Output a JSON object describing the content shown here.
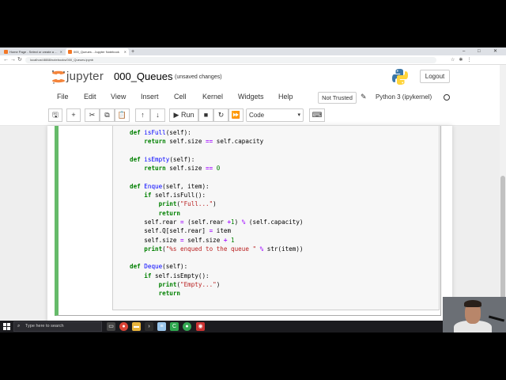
{
  "browser": {
    "tabs": [
      {
        "title": "Home Page - Select or create a ...",
        "active": false
      },
      {
        "title": "000_Queues - Jupyter Notebook",
        "active": true
      }
    ],
    "url": "localhost:8888/notebooks/000_Queues.ipynb"
  },
  "header": {
    "brand": "jupyter",
    "notebook_name": "000_Queues",
    "save_status": "(unsaved changes)",
    "logout_label": "Logout"
  },
  "menu": {
    "items": [
      "File",
      "Edit",
      "View",
      "Insert",
      "Cell",
      "Kernel",
      "Widgets",
      "Help"
    ],
    "trusted_label": "Not Trusted",
    "kernel_name": "Python 3 (ipykernel)"
  },
  "toolbar": {
    "run_label": "Run",
    "cell_type": "Code"
  },
  "taskbar": {
    "search_placeholder": "Type here to search"
  },
  "colors": {
    "selected_cell_border": "#66bb6a",
    "jupyter_orange": "#f37726"
  }
}
